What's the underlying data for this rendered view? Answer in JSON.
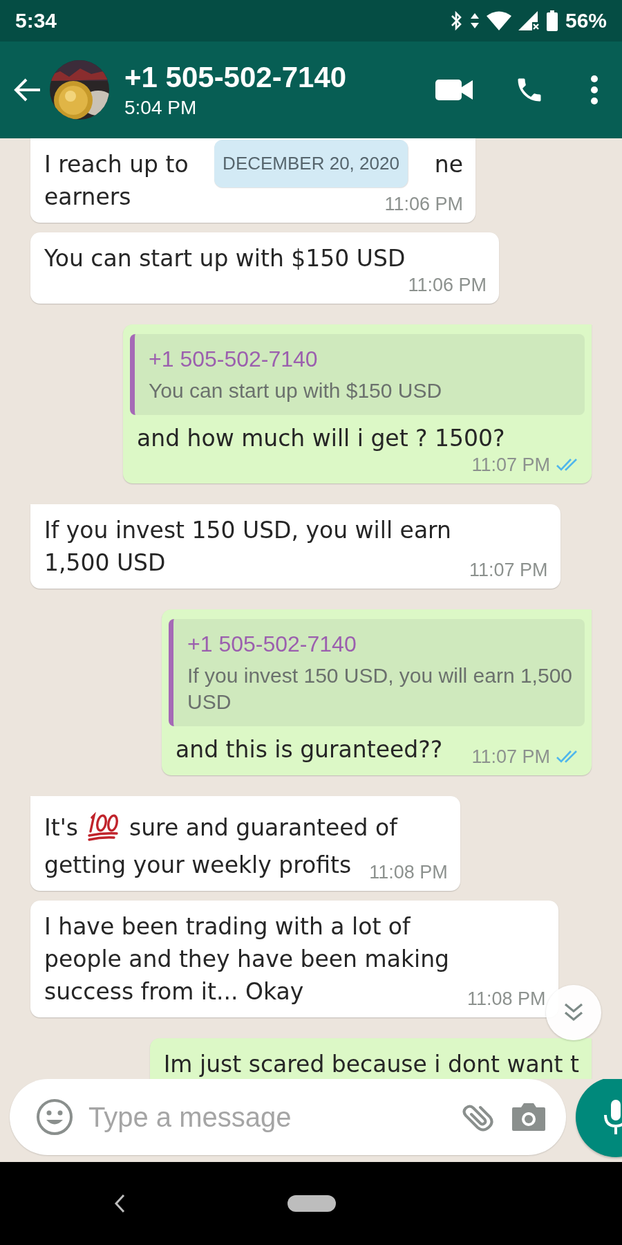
{
  "status_bar": {
    "time": "5:34",
    "battery": "56%"
  },
  "header": {
    "title": "+1 505-502-7140",
    "subtitle": "5:04 PM"
  },
  "date_chip": "DECEMBER 20, 2020",
  "messages": [
    {
      "sent": false,
      "kind": "covered",
      "text_before": "I reach up to",
      "text_after": "ne",
      "text_end": "earners",
      "time": "11:06 PM"
    },
    {
      "sent": false,
      "tail": false,
      "kind": "text",
      "text": "You can start up with $150 USD",
      "time": "11:06 PM"
    },
    {
      "sent": true,
      "tail": true,
      "kind": "reply",
      "quote": {
        "author": "+1 505-502-7140",
        "text": "You can start up with $150 USD"
      },
      "text": "and how much will i get ? 1500?",
      "time": "11:07 PM",
      "read": true
    },
    {
      "sent": false,
      "tail": true,
      "kind": "text",
      "text": "If you invest 150 USD, you will earn\n1,500 USD",
      "time": "11:07 PM"
    },
    {
      "sent": true,
      "tail": true,
      "kind": "reply",
      "quote": {
        "author": "+1 505-502-7140",
        "text": "If you invest 150 USD, you will earn 1,500\nUSD"
      },
      "text": "and this is guranteed??",
      "time": "11:07 PM",
      "read": true
    },
    {
      "sent": false,
      "tail": true,
      "kind": "emoji",
      "text_before": "It's",
      "text_after": "sure and guaranteed of",
      "text_end": "getting your weekly profits",
      "time": "11:08 PM"
    },
    {
      "sent": false,
      "tail": false,
      "kind": "text",
      "text": "I have been trading with a lot of\npeople and they have been making\nsuccess from it... Okay",
      "time": "11:08 PM"
    },
    {
      "sent": true,
      "tail": true,
      "kind": "text",
      "text": "Im just scared because i dont want t"
    }
  ],
  "composer": {
    "placeholder": "Type a message"
  }
}
